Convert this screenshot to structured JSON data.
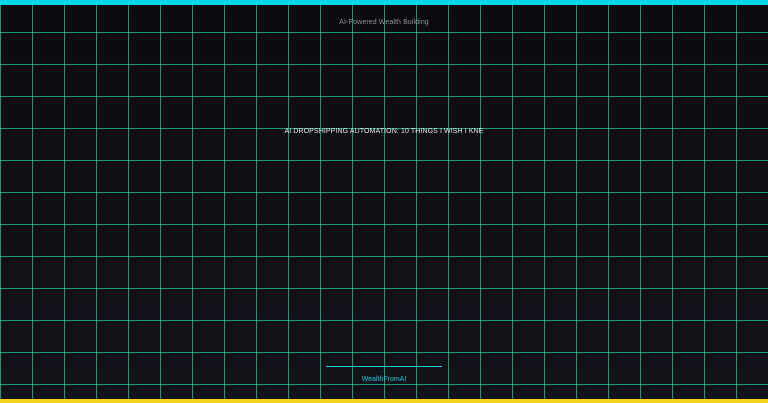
{
  "thumbnail": {
    "kicker": "AI-Powered Wealth Building",
    "headline": "AI DROPSHIPPING AUTOMATION: 10 THINGS I WISH I KNE",
    "brand": "WealthFromAI"
  },
  "colors": {
    "background": "#0d0d12",
    "grid_line": "#1fd39a",
    "top_bar": "#00d8e8",
    "bottom_bar": "#f2d21a",
    "kicker_text": "#8f90a0",
    "headline_text": "#e8e8ee",
    "brand_text": "#1ec8de",
    "accent_line": "#1ec8de"
  }
}
